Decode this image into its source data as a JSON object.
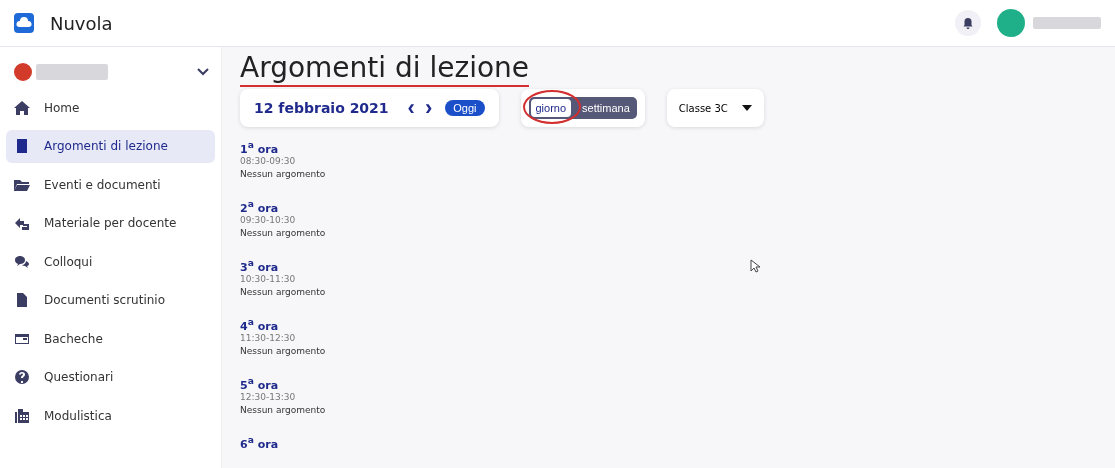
{
  "app": {
    "name": "Nuvola"
  },
  "sidebar": {
    "items": [
      {
        "label": "Home",
        "kind": "home",
        "selected": false
      },
      {
        "label": "Argomenti di lezione",
        "kind": "book",
        "selected": true
      },
      {
        "label": "Eventi e documenti",
        "kind": "folder",
        "selected": false
      },
      {
        "label": "Materiale per docente",
        "kind": "share",
        "selected": false
      },
      {
        "label": "Colloqui",
        "kind": "chat",
        "selected": false
      },
      {
        "label": "Documenti scrutinio",
        "kind": "file",
        "selected": false
      },
      {
        "label": "Bacheche",
        "kind": "board",
        "selected": false
      },
      {
        "label": "Questionari",
        "kind": "question",
        "selected": false
      },
      {
        "label": "Modulistica",
        "kind": "forms",
        "selected": false
      }
    ]
  },
  "page": {
    "title": "Argomenti di lezione"
  },
  "date_nav": {
    "date": "12 febbraio 2021",
    "prev": "‹",
    "next": "›",
    "today": "Oggi"
  },
  "view_toggle": [
    {
      "label": "giorno",
      "selected": true
    },
    {
      "label": "settimana",
      "selected": false
    }
  ],
  "class_select": {
    "value": "Classe 3C"
  },
  "hours": [
    {
      "label": "1$^{a}$ ora",
      "time": "08:30-09:30",
      "note": "Nessun argomento"
    },
    {
      "label": "2$^{a}$ ora",
      "time": "09:30-10:30",
      "note": "Nessun argomento"
    },
    {
      "label": "3$^{a}$ ora",
      "time": "10:30-11:30",
      "note": "Nessun argomento"
    },
    {
      "label": "4$^{a}$ ora",
      "time": "11:30-12:30",
      "note": "Nessun argomento"
    },
    {
      "label": "5$^{a}$ ora",
      "time": "12:30-13:30",
      "note": "Nessun argomento"
    },
    {
      "label": "6$^{a}$ ora"
    }
  ]
}
